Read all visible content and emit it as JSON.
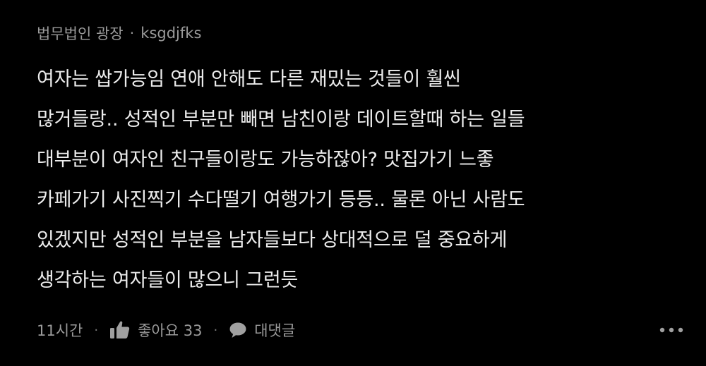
{
  "comment": {
    "category": "법무법인 광장",
    "separator": "·",
    "author": "ksgdjfks",
    "lines": [
      "여자는 쌉가능임 연애 안해도 다른 재밌는 것들이 훨씬",
      "많거들랑.. 성적인 부분만 빼면 남친이랑 데이트할때 하는 일들",
      "대부분이 여자인 친구들이랑도 가능하잖아? 맛집가기 느좋",
      "카페가기 사진찍기 수다떨기 여행가기 등등.. 물론 아닌 사람도",
      "있겠지만 성적인 부분을 남자들보다 상대적으로 덜 중요하게",
      "생각하는 여자들이 많으니 그런듯"
    ],
    "time": "11시간",
    "like_label": "좋아요 33",
    "reply_label": "대댓글",
    "icons": {
      "like": "thumbs-up-icon",
      "reply": "speech-bubble-icon",
      "more": "more-horizontal-icon"
    },
    "colors": {
      "background": "#000000",
      "text": "#ececec",
      "muted": "#9a9a9a"
    }
  }
}
